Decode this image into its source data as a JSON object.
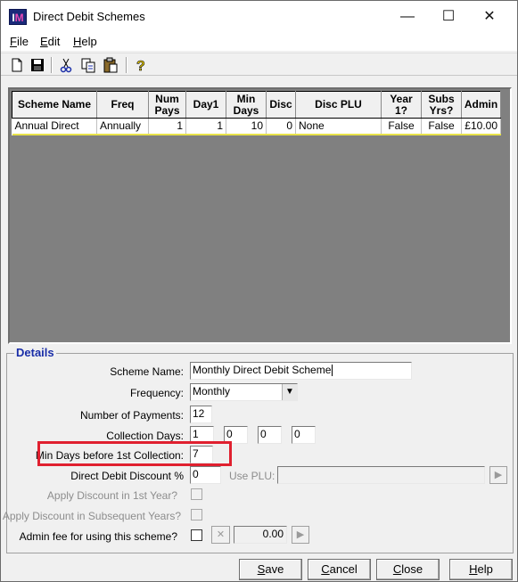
{
  "window": {
    "title": "Direct Debit Schemes",
    "icon": "app-logo-icon",
    "controls": {
      "minimize": "—",
      "maximize": "☐",
      "close": "✕"
    }
  },
  "menu": [
    {
      "pre": "",
      "key": "F",
      "post": "ile"
    },
    {
      "pre": "",
      "key": "E",
      "post": "dit"
    },
    {
      "pre": "",
      "key": "H",
      "post": "elp"
    }
  ],
  "toolbar": {
    "icons": [
      "new-document-icon",
      "save-disk-icon",
      "cut-icon",
      "copy-icon",
      "paste-icon",
      "help-question-icon"
    ]
  },
  "grid": {
    "headers": [
      "Scheme Name",
      "Freq",
      "Num Pays",
      "Day1",
      "Min Days",
      "Disc",
      "Disc PLU",
      "Year 1?",
      "Subs Yrs?",
      "Admin"
    ],
    "rows": [
      [
        "Annual Direct",
        "Annually",
        "1",
        "1",
        "10",
        "0",
        "None",
        "False",
        "False",
        "£10.00"
      ]
    ]
  },
  "details": {
    "legend": "Details",
    "scheme_name_label": "Scheme Name:",
    "scheme_name_value": "Monthly Direct Debit Scheme",
    "frequency_label": "Frequency:",
    "frequency_value": "Monthly",
    "num_payments_label": "Number of Payments:",
    "num_payments_value": "12",
    "collection_days_label": "Collection Days:",
    "collection_days": [
      "1",
      "0",
      "0",
      "0"
    ],
    "min_days_label": "Min Days before 1st Collection:",
    "min_days_value": "7",
    "discount_label": "Direct Debit Discount %",
    "discount_value": "0",
    "use_plu_label": "Use PLU:",
    "use_plu_value": "",
    "apply_first_year_label": "Apply Discount in 1st Year?",
    "apply_subsequent_label": "Apply Discount in Subsequent Years?",
    "admin_fee_label": "Admin fee for using this scheme?",
    "admin_fee_value": "0.00"
  },
  "buttons": {
    "save": {
      "key": "S",
      "rest": "ave"
    },
    "cancel": {
      "key": "C",
      "rest": "ancel"
    },
    "close": {
      "key": "C",
      "rest": "lose"
    },
    "help": {
      "key": "H",
      "rest": "elp"
    }
  },
  "colors": {
    "legend": "#1a2ea8",
    "highlight_box": "#e0202f",
    "grid_background": "#808080",
    "row_underline": "#e8e34a"
  }
}
